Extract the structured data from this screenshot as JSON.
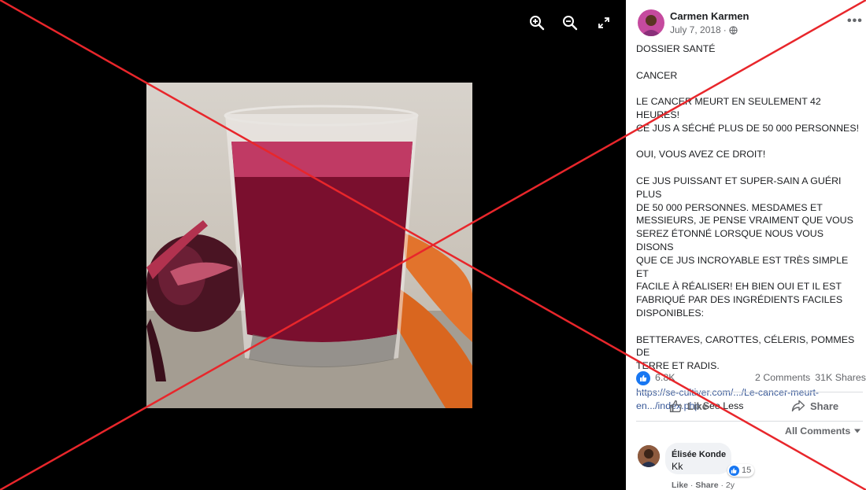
{
  "viewer": {
    "zoom_in_icon": "zoom-in-icon",
    "zoom_out_icon": "zoom-out-icon",
    "fullscreen_icon": "fullscreen-icon"
  },
  "post": {
    "author": "Carmen Karmen",
    "date": "July 7, 2018",
    "separator": "·",
    "privacy_icon": "globe-icon",
    "text": "DOSSIER SANTÉ\n\nCANCER\n\nLE CANCER MEURT EN SEULEMENT 42 HEURES!\nCE JUS A SÉCHÉ PLUS DE 50 000 PERSONNES!\n\nOUI, VOUS AVEZ CE DROIT!\n\nCE JUS PUISSANT ET SUPER-SAIN A GUÉRI PLUS\nDE 50 000 PERSONNES. MESDAMES ET\nMESSIEURS, JE PENSE VRAIMENT QUE VOUS\nSEREZ ÉTONNÉ LORSQUE NOUS VOUS DISONS\nQUE CE JUS INCROYABLE EST TRÈS SIMPLE ET\nFACILE À RÉALISER! EH BIEN OUI ET IL EST\nFABRIQUÉ PAR DES INGRÉDIENTS FACILES\nDISPONIBLES:\n\nBETTERAVES, CAROTTES, CÉLERIS, POMMES DE\nTERRE ET RADIS.\n\n",
    "link": "https://se-cultiver.com/.../Le-cancer-meurt-\nen.../index.php",
    "see_less": "See Less",
    "reactions_count": "6.8K",
    "comments_count": "2 Comments",
    "shares_count": "31K Shares",
    "like_label": "Like",
    "share_label": "Share",
    "all_comments_label": "All Comments"
  },
  "comment": {
    "author": "Élisée Konde",
    "text": "Kk",
    "reaction_count": "15",
    "like_action": "Like",
    "dot": " · ",
    "share_action": "Share",
    "age": "2y"
  },
  "colors": {
    "accent": "#1877f2",
    "link": "#385898",
    "overlay_cross": "#e8262b"
  }
}
